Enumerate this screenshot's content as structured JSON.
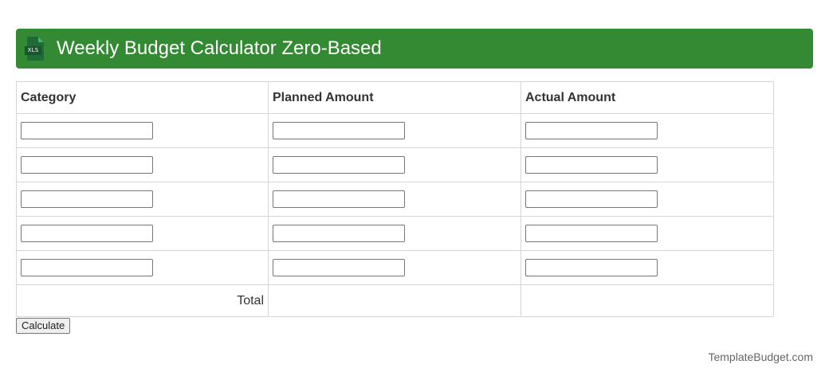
{
  "header": {
    "title": "Weekly Budget Calculator Zero-Based",
    "icon": "xls-file-icon",
    "icon_text": "XLS",
    "background_color": "#338a33"
  },
  "table": {
    "columns": [
      "Category",
      "Planned Amount",
      "Actual Amount"
    ],
    "rows": [
      {
        "category": "",
        "planned": "",
        "actual": ""
      },
      {
        "category": "",
        "planned": "",
        "actual": ""
      },
      {
        "category": "",
        "planned": "",
        "actual": ""
      },
      {
        "category": "",
        "planned": "",
        "actual": ""
      },
      {
        "category": "",
        "planned": "",
        "actual": ""
      }
    ],
    "total_label": "Total",
    "total_planned": "",
    "total_actual": ""
  },
  "actions": {
    "calculate_label": "Calculate"
  },
  "footer": {
    "credit": "TemplateBudget.com"
  }
}
